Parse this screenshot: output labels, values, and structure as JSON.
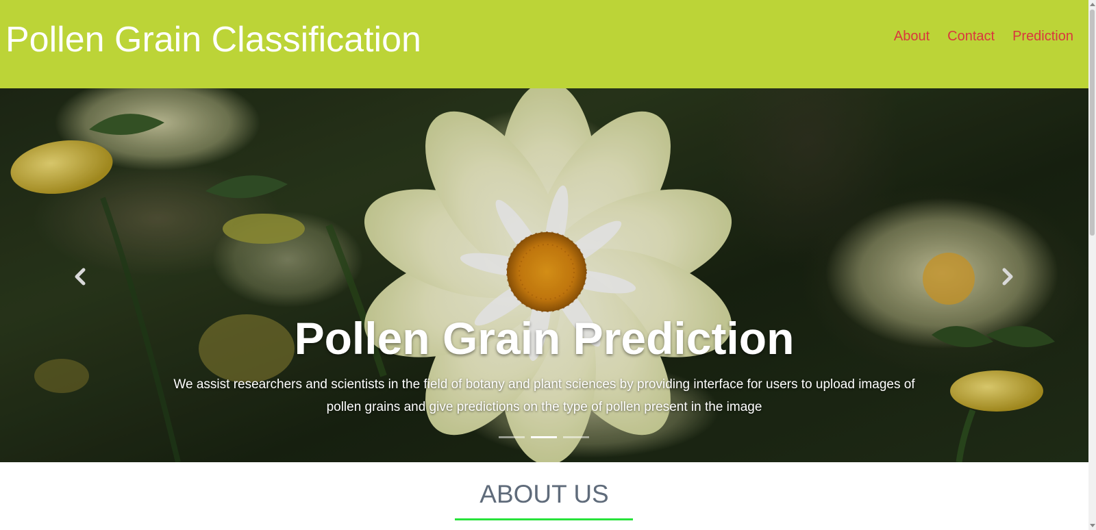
{
  "header": {
    "brand": "Pollen Grain Classification",
    "nav": [
      "About",
      "Contact",
      "Prediction"
    ],
    "background_color": "#bcd437",
    "nav_color": "#d9363e"
  },
  "carousel": {
    "title": "Pollen Grain Prediction",
    "text": "We assist researchers and scientists in the field of botany and plant sciences by providing interface for users to upload images of pollen grains and give predictions on the type of pollen present in the image",
    "slide_count": 3,
    "active_slide": 2,
    "prev_icon": "chevron-left-icon",
    "next_icon": "chevron-right-icon"
  },
  "about": {
    "title": "ABOUT US",
    "underline_color": "#27e33a"
  }
}
